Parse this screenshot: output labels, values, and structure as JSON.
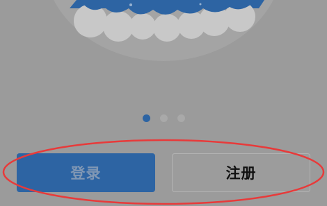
{
  "buttons": {
    "login_label": "登录",
    "register_label": "注册"
  },
  "pager": {
    "total": 3,
    "active_index": 0
  },
  "colors": {
    "primary": "#2d64a3",
    "overlay_gray": "#9b9b9b",
    "annotation_red": "#e83a3a"
  },
  "icons": {
    "hero": "cloud-illustration",
    "annotation": "red-ellipse-highlight"
  }
}
